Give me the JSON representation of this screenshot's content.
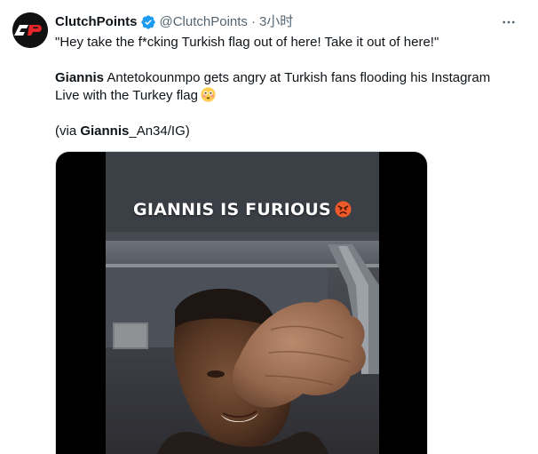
{
  "tweet": {
    "author": {
      "display_name": "ClutchPoints",
      "handle": "@ClutchPoints",
      "separator": "·",
      "time": "3小时",
      "avatar_icon": "clutchpoints-logo",
      "verified_icon": "verified-badge-icon"
    },
    "more_icon": "more-options-icon",
    "lines": {
      "quote": "\"Hey take the f*cking Turkish flag out of here! Take it out of here!\"",
      "line2_bold": "Giannis",
      "line2_rest": " Antetokounmpo gets angry at Turkish fans flooding his Instagram",
      "line3": "Live with the Turkey flag",
      "line3_emoji": "flushed-face-emoji",
      "via_prefix": "(via ",
      "via_bold": "Giannis",
      "via_rest": "_An34/IG)"
    },
    "media": {
      "type": "video",
      "overlay_caption": "GIANNIS IS FURIOUS",
      "overlay_emoji": "angry-face-emoji"
    }
  },
  "colors": {
    "text": "#0f1419",
    "secondary": "#536471",
    "verified": "#1d9bf0",
    "brand_red": "#e4252a"
  }
}
